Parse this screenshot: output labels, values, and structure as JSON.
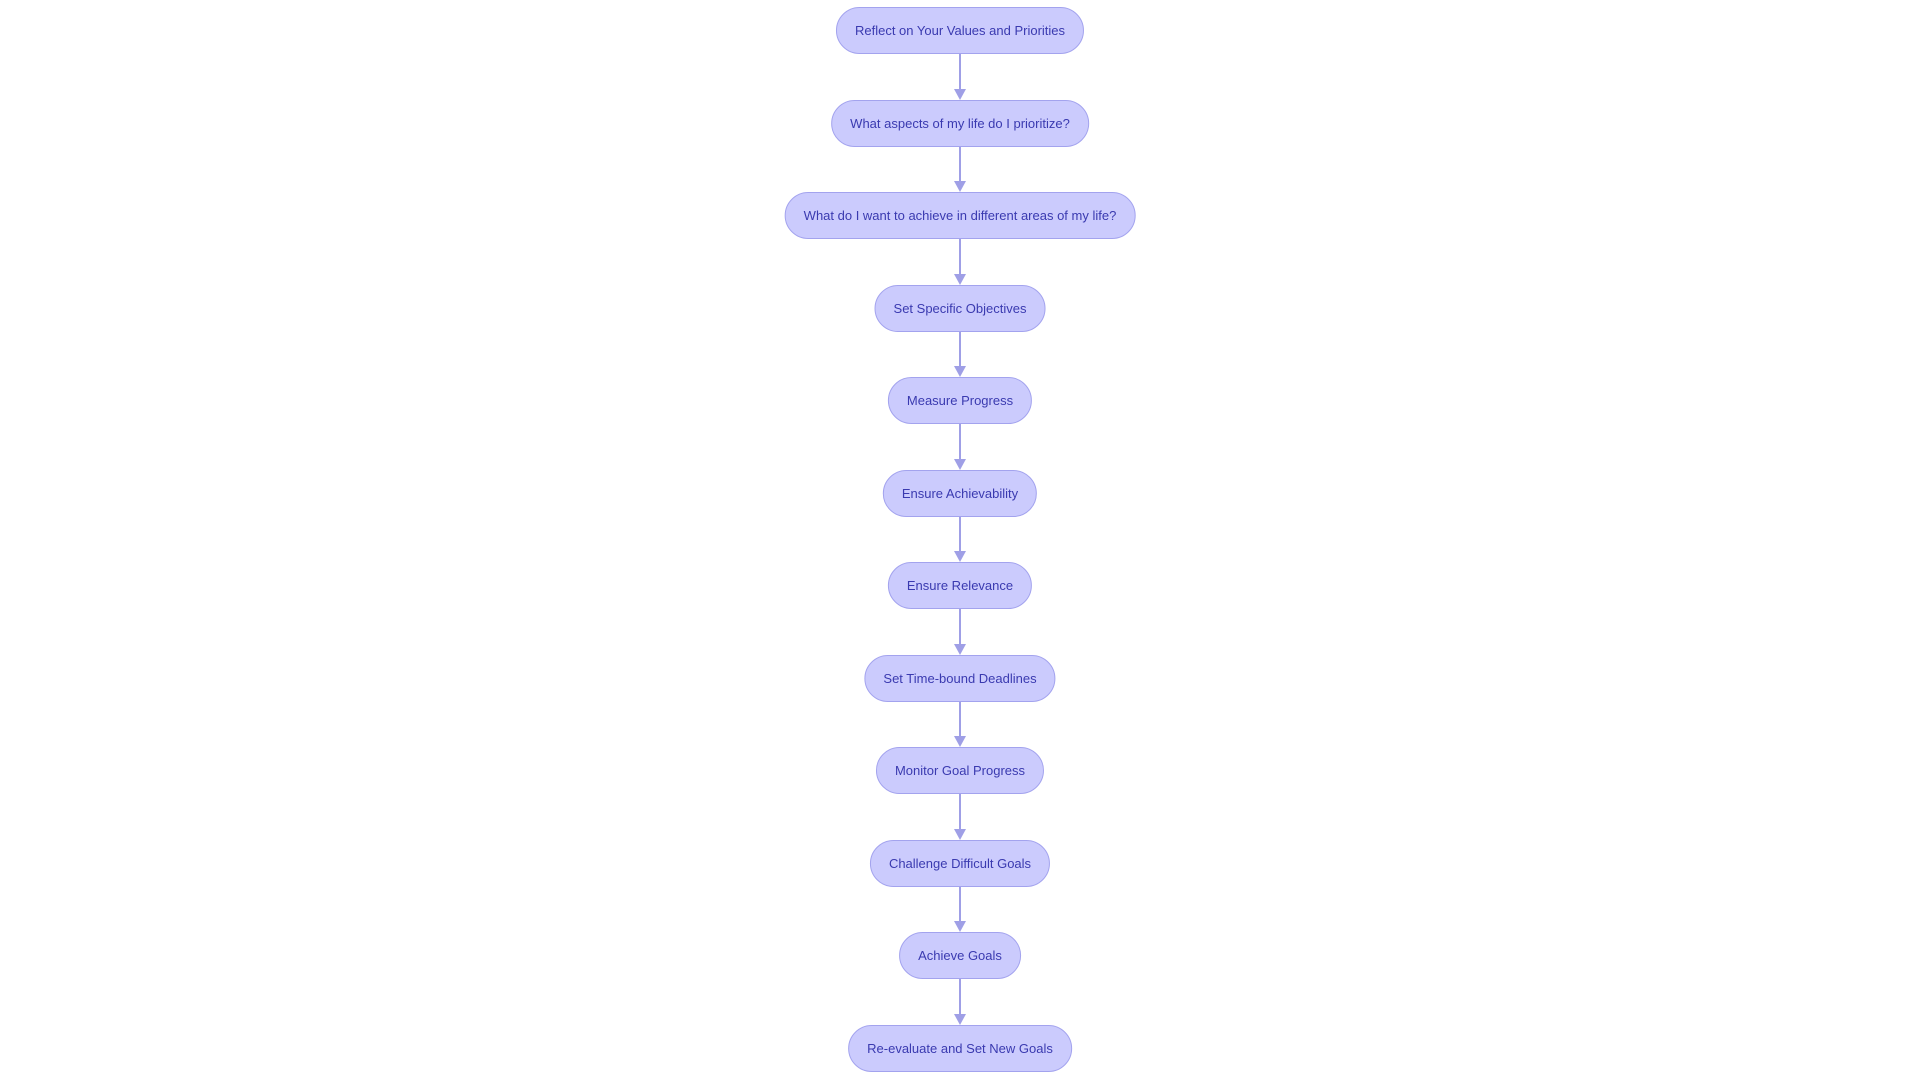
{
  "diagram": {
    "type": "flowchart",
    "direction": "top-down",
    "colors": {
      "node_fill": "#cbcbfd",
      "node_border": "#a3a3ee",
      "text": "#3a3ab0",
      "edge": "#9f9fe6"
    },
    "nodes": [
      "Reflect on Your Values and Priorities",
      "What aspects of my life do I prioritize?",
      "What do I want to achieve in different areas of my life?",
      "Set Specific Objectives",
      "Measure Progress",
      "Ensure Achievability",
      "Ensure Relevance",
      "Set Time-bound Deadlines",
      "Monitor Goal Progress",
      "Challenge Difficult Goals",
      "Achieve Goals",
      "Re-evaluate and Set New Goals"
    ]
  }
}
